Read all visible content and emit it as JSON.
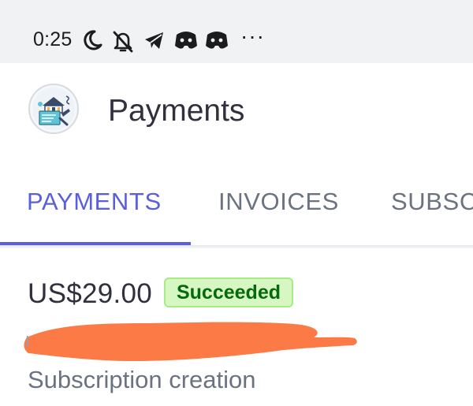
{
  "status_bar": {
    "time": "0:25",
    "icons": [
      "moon-icon",
      "bell-off-icon",
      "telegram-icon",
      "discord-icon",
      "discord-icon"
    ],
    "more": "···"
  },
  "header": {
    "title": "Payments",
    "logo": "app-logo"
  },
  "tabs": [
    {
      "label": "PAYMENTS",
      "active": true
    },
    {
      "label": "INVOICES",
      "active": false
    },
    {
      "label": "SUBSC",
      "active": false
    }
  ],
  "payment": {
    "amount": "US$29.00",
    "status": "Succeeded",
    "description": "Subscription creation"
  },
  "colors": {
    "accent": "#5a5fdc",
    "status_success_bg": "#d7f7c2",
    "status_success_text": "#05690d",
    "redaction": "#fb7a45"
  }
}
